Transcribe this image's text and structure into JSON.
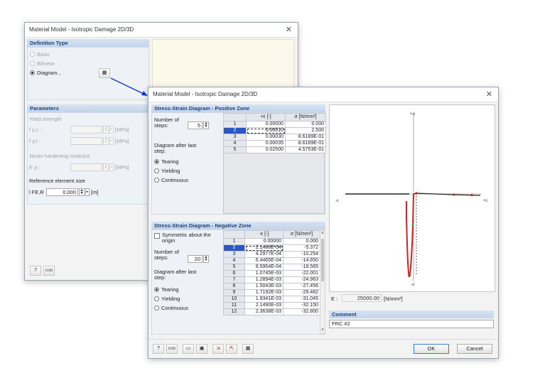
{
  "colors": {
    "accent": "#1f3f79",
    "selection": "#2a56c6",
    "curve": "#cc2222",
    "connector_arrow": "#1536c4"
  },
  "back_dialog": {
    "title": "Material Model - Isotropic Damage 2D/3D",
    "close_icon": "close-icon",
    "definition_type": {
      "header": "Definition Type",
      "options": [
        {
          "label": "Basic",
          "selected": false
        },
        {
          "label": "Bilinear",
          "selected": false
        },
        {
          "label": "Diagram...",
          "selected": true
        }
      ],
      "edit_diagram_icon": "table-edit-icon"
    },
    "parameters": {
      "header": "Parameters",
      "yield_strength_label": "Yield strength",
      "fy_c_label": "f y,c :",
      "fy_t_label": "f y,t :",
      "unit_mpa": "[MPa]",
      "strain_hardening_label": "Strain hardening modulus",
      "ep_label": "E p :",
      "ref_size_label": "Reference element size",
      "lfe_label": "l FE,R",
      "lfe_value": "0.000",
      "lfe_unit": "[m]"
    },
    "footer_icons": [
      "help-icon",
      "units-icon"
    ]
  },
  "front_dialog": {
    "title": "Material Model - Isotropic Damage 2D/3D",
    "positive": {
      "header": "Stress-Strain Diagram - Positive Zone",
      "steps_label": "Number of steps:",
      "steps_value": "5",
      "after_last_label": "Diagram after last step:",
      "options": [
        {
          "label": "Tearing",
          "selected": true
        },
        {
          "label": "Yielding",
          "selected": false
        },
        {
          "label": "Continuous",
          "selected": false
        }
      ],
      "columns": [
        "+ε [-]",
        "σ [N/mm²]"
      ],
      "rows": [
        [
          "1",
          "0.00000",
          "0.000"
        ],
        [
          "2",
          "0.00010",
          "2.500"
        ],
        [
          "3",
          "0.00030",
          "8.6189E-01"
        ],
        [
          "4",
          "0.00035",
          "8.6189E-01"
        ],
        [
          "5",
          "0.02500",
          "4.5753E-01"
        ]
      ],
      "selected_row": "2"
    },
    "negative": {
      "header": "Stress-Strain Diagram - Negative Zone",
      "symmetric_label": "Symmetric about the origin",
      "steps_label": "Number of steps:",
      "steps_value": "20",
      "after_last_label": "Diagram after last step:",
      "options": [
        {
          "label": "Tearing",
          "selected": true
        },
        {
          "label": "Yielding",
          "selected": false
        },
        {
          "label": "Continuous",
          "selected": false
        }
      ],
      "columns": [
        "-ε [-]",
        "σ [N/mm²]"
      ],
      "rows": [
        [
          "1",
          "0.00000",
          "0.000"
        ],
        [
          "2",
          "2.1488E-04",
          "-5.372"
        ],
        [
          "3",
          "4.2977E-04",
          "-10.254"
        ],
        [
          "4",
          "6.4465E-04",
          "-14.650"
        ],
        [
          "5",
          "8.5954E-04",
          "-18.565"
        ],
        [
          "6",
          "1.0745E-03",
          "-22.001"
        ],
        [
          "7",
          "1.2894E-03",
          "-24.963"
        ],
        [
          "8",
          "1.5043E-03",
          "-27.456"
        ],
        [
          "9",
          "1.7192E-03",
          "-29.482"
        ],
        [
          "10",
          "1.9341E-03",
          "-31.045"
        ],
        [
          "11",
          "2.1490E-03",
          "-32.150"
        ],
        [
          "12",
          "2.3638E-03",
          "-32.800"
        ]
      ],
      "selected_row": "2"
    },
    "chart": {
      "top_label": "+σ",
      "bottom_label": "-σ",
      "left_label": "-ε",
      "right_label": "+ε"
    },
    "e_modulus": {
      "label": "E :",
      "value": "25000.00",
      "unit": "[N/mm²]"
    },
    "comment": {
      "header": "Comment",
      "value": "FRC #2"
    },
    "buttons": {
      "ok": "OK",
      "cancel": "Cancel"
    },
    "footer_icons": [
      "help-icon",
      "units-icon",
      "open-icon",
      "save-icon",
      "import-icon",
      "export-icon",
      "table-icon"
    ]
  }
}
